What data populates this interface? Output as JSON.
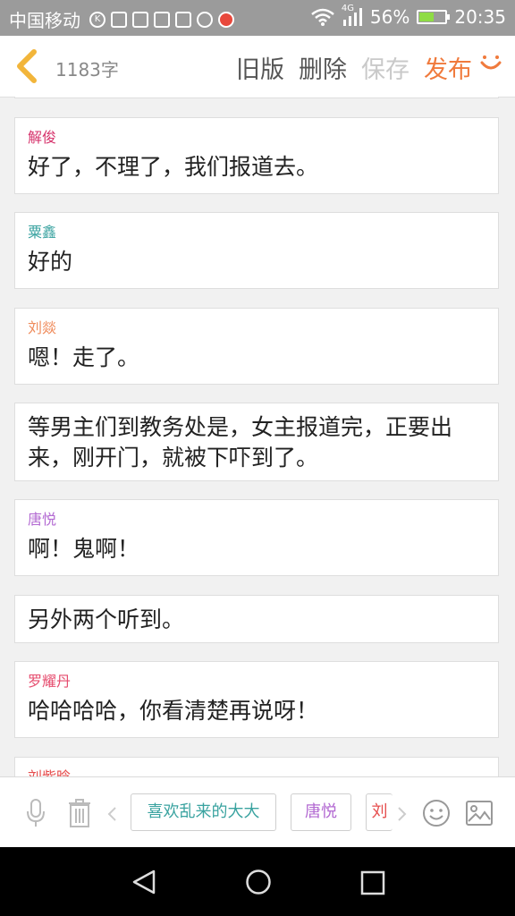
{
  "statusbar": {
    "carrier": "中国移动",
    "battery": "56%",
    "battery_level": 0.56,
    "time": "20:35",
    "network": "4G"
  },
  "header": {
    "word_count": "1183字",
    "old_version": "旧版",
    "delete": "删除",
    "save": "保存",
    "publish": "发布"
  },
  "messages": [
    {
      "speaker": "",
      "text": ""
    },
    {
      "speaker": "解俊",
      "color": "#d6336c",
      "text": "好了，不理了，我们报道去。"
    },
    {
      "speaker": "粟鑫",
      "color": "#3aa3a0",
      "text": "好的"
    },
    {
      "speaker": "刘燚",
      "color": "#ef8a5a",
      "text": "嗯！走了。"
    },
    {
      "speaker": "",
      "text": "等男主们到教务处是，女主报道完，正要出来，刚开门，就被下吓到了。"
    },
    {
      "speaker": "唐悦",
      "color": "#b36ad2",
      "text": "啊！鬼啊！"
    },
    {
      "speaker": "",
      "text": "另外两个听到。"
    },
    {
      "speaker": "罗耀丹",
      "color": "#e64c6e",
      "text": "哈哈哈哈，你看清楚再说呀！"
    },
    {
      "speaker": "刘紫晗",
      "color": "#e64c4c",
      "text": ""
    }
  ],
  "bottombar": {
    "chips": [
      {
        "label": "喜欢乱来的大大",
        "color": "#3aa3a0"
      },
      {
        "label": "唐悦",
        "color": "#b36ad2"
      },
      {
        "label": "刘",
        "color": "#e64c4c"
      }
    ]
  }
}
